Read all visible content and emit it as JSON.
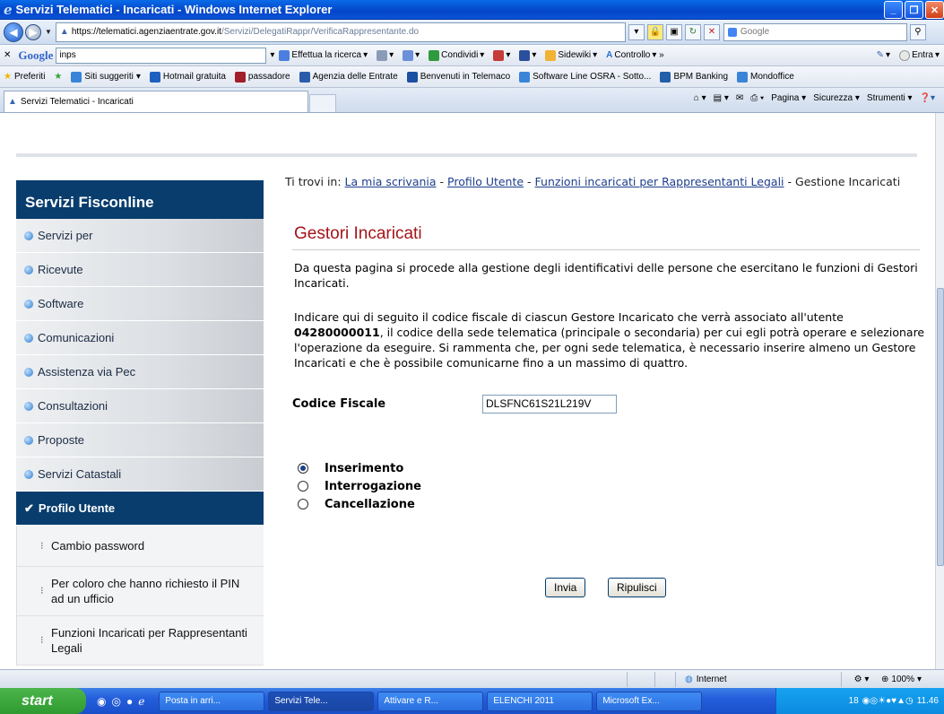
{
  "window": {
    "title": "Servizi Telematici - Incaricati - Windows Internet Explorer"
  },
  "address": {
    "host": "https://telematici.agenziaentrate.gov.it",
    "path": "/Servizi/DelegatiRappr/VerificaRappresentante.do",
    "search_placeholder": "Google"
  },
  "google_toolbar": {
    "logo": "Google",
    "query": "inps",
    "items": [
      "Effettua la ricerca",
      "Condividi",
      "Sidewiki",
      "Controllo",
      "Entra"
    ]
  },
  "favorites": {
    "label": "Preferiti",
    "items": [
      "Siti suggeriti",
      "Hotmail gratuita",
      "passadore",
      "Agenzia delle Entrate",
      "Benvenuti in Telemaco",
      "Software Line OSRA - Sotto...",
      "BPM Banking",
      "Mondoffice"
    ]
  },
  "tab": {
    "label": "Servizi Telematici - Incaricati"
  },
  "commandbar": {
    "items": [
      "Pagina",
      "Sicurezza",
      "Strumenti"
    ]
  },
  "sidebar": {
    "title": "Servizi Fisconline",
    "items": [
      "Servizi per",
      "Ricevute",
      "Software",
      "Comunicazioni",
      "Assistenza via Pec",
      "Consultazioni",
      "Proposte",
      "Servizi Catastali"
    ],
    "active": "Profilo Utente",
    "subitems": [
      "Cambio password",
      "Per coloro che hanno richiesto il PIN ad un ufficio",
      "Funzioni Incaricati per Rappresentanti Legali"
    ]
  },
  "breadcrumb": {
    "prefix": "Ti trovi in:",
    "links": [
      "La mia scrivania",
      "Profilo Utente",
      "Funzioni incaricati per Rappresentanti Legali"
    ],
    "current": "Gestione Incaricati"
  },
  "main": {
    "heading": "Gestori Incaricati",
    "p1": "Da questa pagina si procede alla gestione degli identificativi delle persone che esercitano le funzioni di Gestori Incaricati.",
    "p2_before": "Indicare qui di seguito il codice fiscale di ciascun Gestore Incaricato che verrà associato all'utente ",
    "p2_user": "04280000011",
    "p2_after": ", il codice della sede telematica (principale o secondaria) per cui egli potrà operare e selezionare l'operazione da eseguire. Si rammenta che, per ogni sede telematica, è necessario inserire almeno un Gestore Incaricati e che è possibile comunicarne fino a un massimo di quattro.",
    "cf_label": "Codice Fiscale",
    "cf_value": "DLSFNC61S21L219V",
    "options": [
      "Inserimento",
      "Interrogazione",
      "Cancellazione"
    ],
    "selected": "Inserimento",
    "submit": "Invia",
    "reset": "Ripulisci"
  },
  "statusbar": {
    "zone": "Internet",
    "zoom": "100%"
  },
  "taskbar": {
    "start": "start",
    "tasks": [
      "Posta in arri...",
      "Servizi Tele...",
      "Attivare e R...",
      "ELENCHI 2011",
      "Microsoft Ex..."
    ],
    "clock": "11.46",
    "tray_text": "18"
  }
}
